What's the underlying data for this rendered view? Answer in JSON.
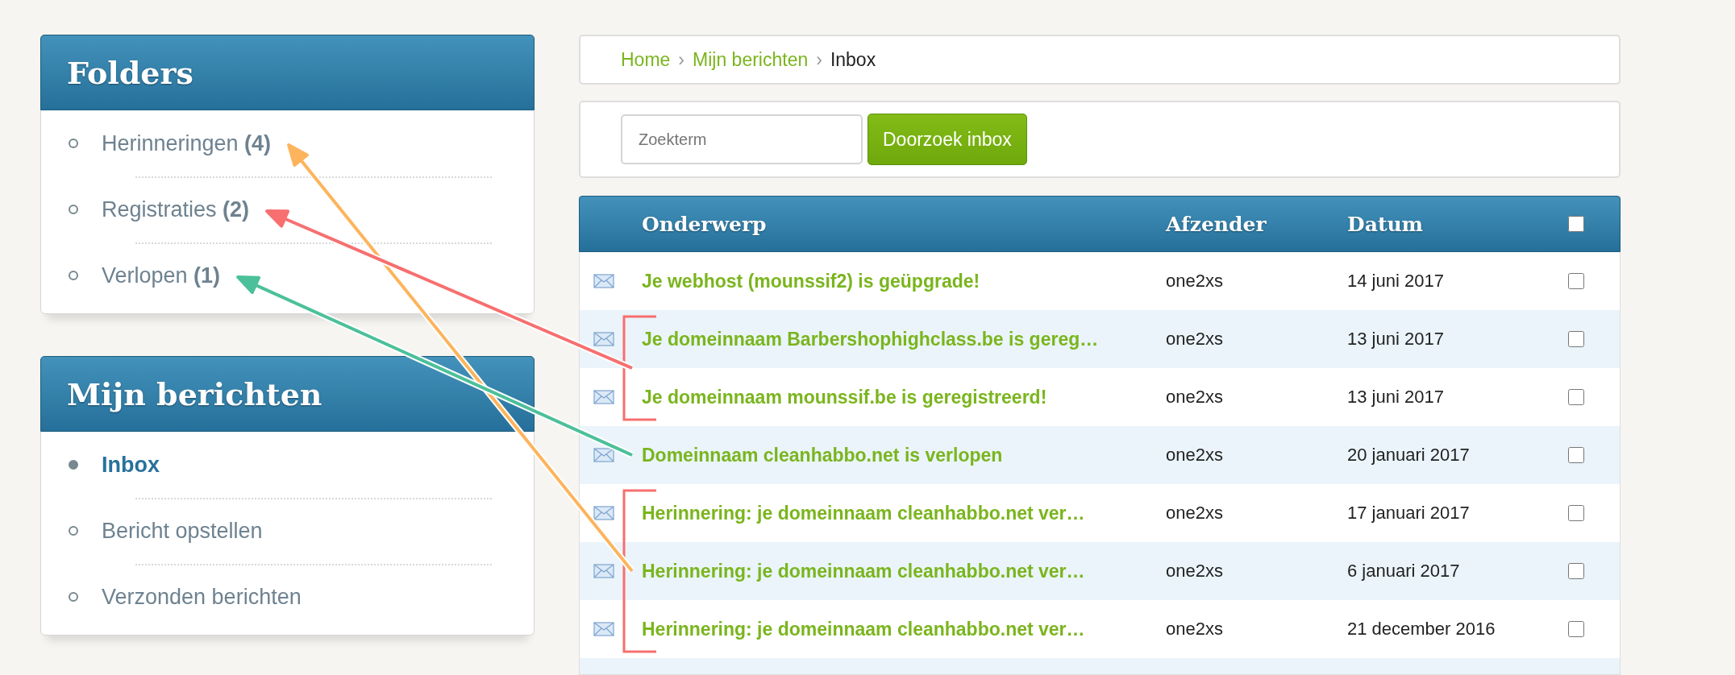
{
  "panels": [
    {
      "kind": "menu",
      "title": "Folders",
      "items": [
        {
          "label": "Herinneringen **(4)**",
          "selected": false,
          "color": "#fdb45c"
        },
        {
          "label": "Registraties **(2)**",
          "selected": false,
          "color": "#f76f6f"
        },
        {
          "label": "Verlopen **(1)**",
          "selected": false,
          "color": "#4cc09a"
        }
      ]
    },
    {
      "kind": "menu",
      "title": "Mijn berichten",
      "items": [
        {
          "label": "Inbox",
          "selected": true
        },
        {
          "label": "Bericht opstellen",
          "selected": false
        },
        {
          "label": "Verzonden berichten",
          "selected": false
        }
      ]
    },
    {
      "kind": "cut_off"
    }
  ],
  "breadcrumb": {
    "links": [
      "Home",
      "Mijn berichten"
    ],
    "current": "Inbox",
    "separator": "›"
  },
  "search": {
    "placeholder": "Zoekterm",
    "button": "Doorzoek inbox"
  },
  "table": {
    "columns": [
      "Onderwerp",
      "Afzender",
      "Datum"
    ],
    "select_all": {
      "checked": false
    },
    "rows": [
      {
        "subject": "Je webhost (mounssif2) is geüpgrade!",
        "sender": "one2xs",
        "date": "14 juni 2017",
        "checked": false,
        "bracket": false
      },
      {
        "subject": "Je domeinnaam Barbershophighclass.be is gereg…",
        "sender": "one2xs",
        "date": "13 juni 2017",
        "checked": false,
        "bracket": true
      },
      {
        "subject": "Je domeinnaam mounssif.be is geregistreerd!",
        "sender": "one2xs",
        "date": "13 juni 2017",
        "checked": false,
        "bracket": true
      },
      {
        "subject": "Domeinnaam cleanhabbo.net is verlopen",
        "sender": "one2xs",
        "date": "20 januari 2017",
        "checked": false,
        "bracket": false
      },
      {
        "subject": "Herinnering: je domeinnaam cleanhabbo.net ver…",
        "sender": "one2xs",
        "date": "17 januari 2017",
        "checked": false,
        "bracket": true
      },
      {
        "subject": "Herinnering: je domeinnaam cleanhabbo.net ver…",
        "sender": "one2xs",
        "date": "6 januari 2017",
        "checked": false,
        "bracket": true
      },
      {
        "subject": "Herinnering: je domeinnaam cleanhabbo.net ver…",
        "sender": "one2xs",
        "date": "21 december 2016",
        "checked": false,
        "bracket": true
      }
    ]
  }
}
